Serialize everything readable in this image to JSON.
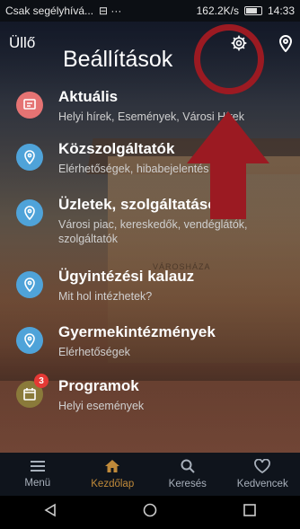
{
  "status_bar": {
    "left": "Csak segélyhívá...",
    "mid": "⊟ ···",
    "speed": "162.2K/s",
    "time": "14:33"
  },
  "header": {
    "back_label": "Üllő",
    "title": "Beállítások",
    "settings_icon": "gear-icon",
    "location_icon": "map-pin-icon"
  },
  "menu": [
    {
      "title": "Aktuális",
      "subtitle": "Helyi hírek, Események, Városi Hírek",
      "icon": "message-icon",
      "color": "#e57373",
      "badge": ""
    },
    {
      "title": "Közszolgáltatók",
      "subtitle": "Elérhetőségek, hibabejelentés",
      "icon": "map-pin-icon",
      "color": "#4fa3d9",
      "badge": ""
    },
    {
      "title": "Üzletek, szolgáltatások",
      "subtitle": "Városi piac, kereskedők, vendéglátók, szolgáltatók",
      "icon": "map-pin-icon",
      "color": "#4fa3d9",
      "badge": ""
    },
    {
      "title": "Ügyintézési kalauz",
      "subtitle": "Mit hol intézhetek?",
      "icon": "map-pin-icon",
      "color": "#4fa3d9",
      "badge": ""
    },
    {
      "title": "Gyermekintézmények",
      "subtitle": "Elérhetőségek",
      "icon": "map-pin-icon",
      "color": "#4fa3d9",
      "badge": ""
    },
    {
      "title": "Programok",
      "subtitle": "Helyi események",
      "icon": "calendar-icon",
      "color": "#8a7a3a",
      "badge": "3"
    }
  ],
  "background_sign": "VÁROSHÁZA",
  "tabs": [
    {
      "label": "Menü",
      "icon": "hamburger-icon",
      "active": false
    },
    {
      "label": "Kezdőlap",
      "icon": "home-icon",
      "active": true
    },
    {
      "label": "Keresés",
      "icon": "search-icon",
      "active": false
    },
    {
      "label": "Kedvencek",
      "icon": "heart-icon",
      "active": false
    }
  ],
  "colors": {
    "accent": "#c08a3a",
    "annotation": "#9b1a22",
    "tab_bar": "#0f141c"
  },
  "nav_bar": [
    "back-triangle-icon",
    "home-circle-icon",
    "recents-square-icon"
  ]
}
